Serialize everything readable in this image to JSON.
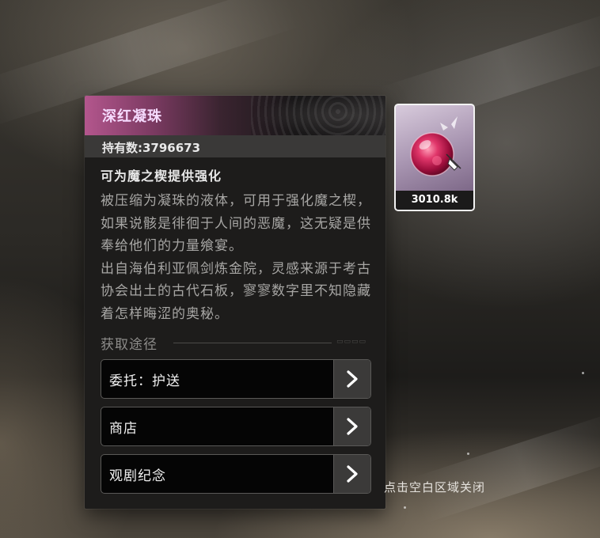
{
  "item": {
    "name": "深红凝珠",
    "count_label": "持有数:3796673",
    "desc_title": "可为魔之楔提供强化",
    "desc_body": "被压缩为凝珠的液体，可用于强化魔之楔，如果说骸是徘徊于人间的恶魔，这无疑是供奉给他们的力量飨宴。\n出自海伯利亚佩剑炼金院，灵感来源于考古协会出土的古代石板，寥寥数字里不知隐藏着怎样晦涩的奥秘。"
  },
  "source": {
    "label": "获取途径",
    "routes": [
      {
        "label": "委托：护送",
        "icon": "chevron-right-icon"
      },
      {
        "label": "商店",
        "icon": "chevron-right-icon"
      },
      {
        "label": "观剧纪念",
        "icon": "chevron-right-icon"
      }
    ]
  },
  "card": {
    "quantity": "3010.8k",
    "icon": "crimson-orb-icon"
  },
  "hint": "点击空白区域关闭",
  "colors": {
    "title_gradient_start": "#b3568d",
    "title_text": "#f6dbff",
    "panel_bg": "#1d1c1b",
    "route_bg": "#050505",
    "arrow_bg": "#3b3a39"
  }
}
